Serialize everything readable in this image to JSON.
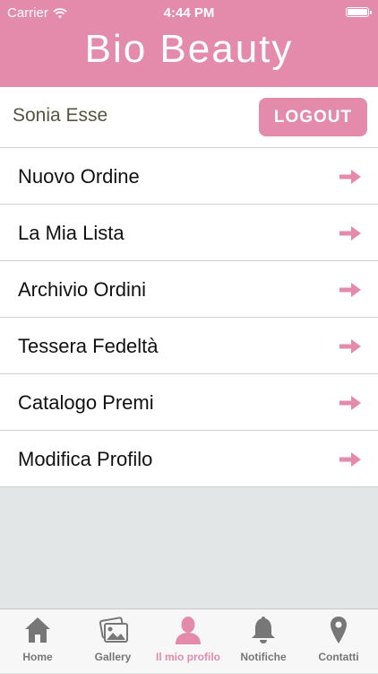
{
  "status_bar": {
    "carrier": "Carrier",
    "time": "4:44 PM"
  },
  "header": {
    "title": "Bio Beauty"
  },
  "user": {
    "name": "Sonia Esse",
    "logout_label": "LOGOUT"
  },
  "menu": {
    "items": [
      {
        "label": "Nuovo Ordine"
      },
      {
        "label": "La Mia Lista"
      },
      {
        "label": "Archivio Ordini"
      },
      {
        "label": "Tessera Fedeltà"
      },
      {
        "label": "Catalogo Premi"
      },
      {
        "label": "Modifica Profilo"
      }
    ]
  },
  "tabbar": {
    "tabs": [
      {
        "label": "Home",
        "icon": "home-icon"
      },
      {
        "label": "Gallery",
        "icon": "gallery-icon"
      },
      {
        "label": "Il mio profilo",
        "icon": "profile-icon",
        "active": true
      },
      {
        "label": "Notifiche",
        "icon": "bell-icon"
      },
      {
        "label": "Contatti",
        "icon": "location-pin-icon"
      }
    ]
  },
  "colors": {
    "brand_pink": "#e48bab",
    "tab_inactive": "#777777",
    "background": "#e3e6e7"
  }
}
